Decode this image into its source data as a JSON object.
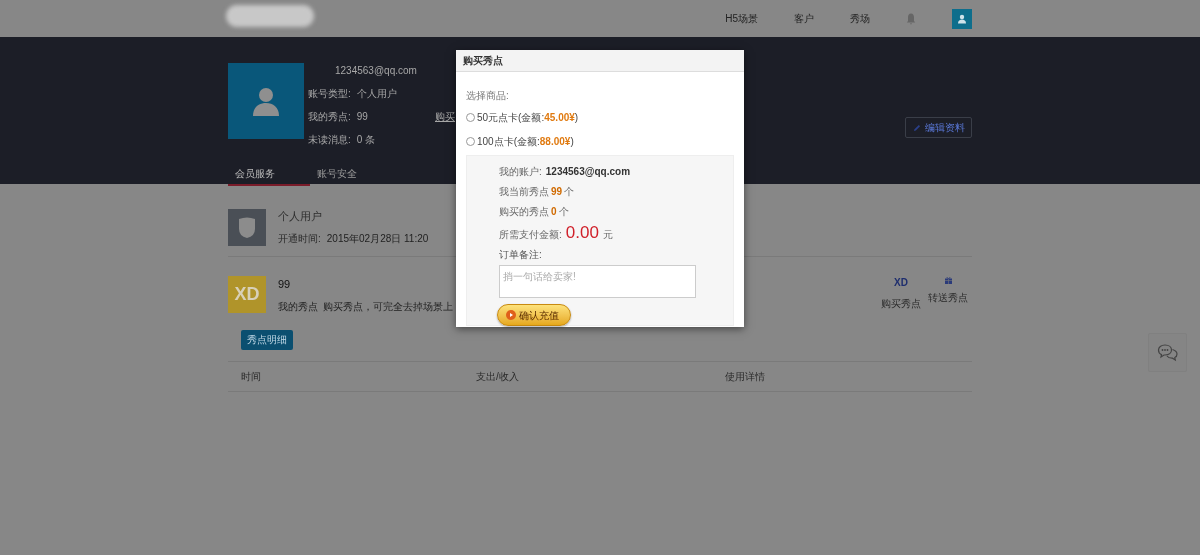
{
  "nav": {
    "items": [
      "H5场景",
      "客户",
      "秀场"
    ]
  },
  "profile": {
    "email": "1234563@qq.com",
    "fields": [
      {
        "label": "账号类型:",
        "value": "个人用户"
      },
      {
        "label": "我的秀点:",
        "value": "99"
      },
      {
        "label": "未读消息:",
        "value": "0 条"
      }
    ],
    "buy_link": "购买",
    "edit_button": "编辑资料"
  },
  "tabs": [
    {
      "label": "会员服务",
      "selected": true
    },
    {
      "label": "账号安全",
      "selected": false
    }
  ],
  "account": {
    "title": "个人用户",
    "opened_label": "开通时间:",
    "opened_value": "2015年02月28日 11:20"
  },
  "points": {
    "value": "99",
    "label": "我的秀点",
    "description": "购买秀点，可完全去掉场景上",
    "icon_text": "XD",
    "actions": [
      "购买秀点",
      "转送秀点"
    ],
    "action_icon_text": "XD",
    "detail_button": "秀点明细"
  },
  "table": {
    "columns": [
      "时间",
      "支出/收入",
      "使用详情"
    ]
  },
  "modal": {
    "title": "购买秀点",
    "choose_label": "选择商品:",
    "options": [
      {
        "name": "50元点卡(金额:",
        "price": "45.00¥",
        "suffix": ")",
        "selected": false
      },
      {
        "name": "100点卡(金额:",
        "price": "88.00¥",
        "suffix": ")",
        "selected": false
      }
    ],
    "account_label": "我的账户:",
    "account_value": "1234563@qq.com",
    "current_label": "我当前秀点",
    "current_value": "99",
    "current_unit": "个",
    "bought_label": "购买的秀点",
    "bought_value": "0",
    "bought_unit": "个",
    "pay_label": "所需支付金额:",
    "pay_value": "0.00",
    "pay_unit": "元",
    "note_label": "订单备注:",
    "note_placeholder": "捎一句话给卖家!",
    "confirm_button": "确认充值"
  }
}
